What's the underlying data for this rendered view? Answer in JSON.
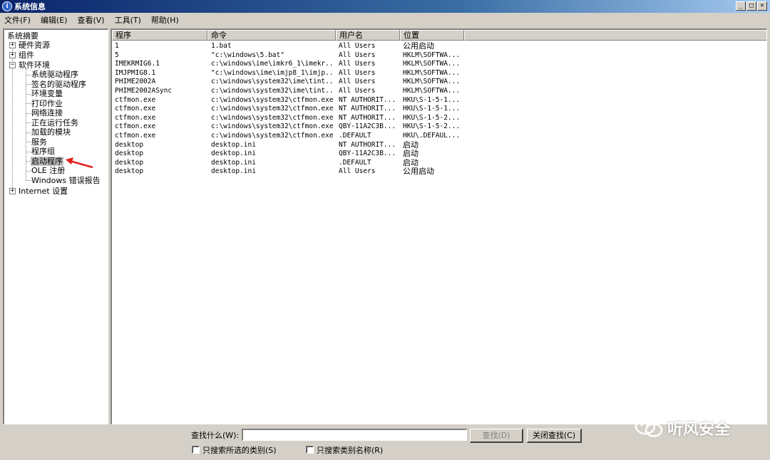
{
  "window": {
    "title": "系统信息",
    "min": "_",
    "max": "□",
    "close": "×"
  },
  "menu": [
    "文件(F)",
    "编辑(E)",
    "查看(V)",
    "工具(T)",
    "帮助(H)"
  ],
  "tree": {
    "root": "系统摘要",
    "hardware": "硬件资源",
    "components": "组件",
    "software": "软件环境",
    "software_children": [
      "系统驱动程序",
      "签名的驱动程序",
      "环境变量",
      "打印作业",
      "网络连接",
      "正在运行任务",
      "加载的模块",
      "服务",
      "程序组",
      "启动程序",
      "OLE 注册",
      "Windows 错误报告"
    ],
    "internet": "Internet 设置",
    "selected": "启动程序"
  },
  "table": {
    "columns": [
      "程序",
      "命令",
      "用户名",
      "位置"
    ],
    "rows": [
      [
        "1",
        "1.bat",
        "All Users",
        "公用启动"
      ],
      [
        "5",
        "\"c:\\windows\\5.bat\"",
        "All Users",
        "HKLM\\SOFTWA..."
      ],
      [
        "IMEKRMIG6.1",
        "c:\\windows\\ime\\imkr6_1\\imekr...",
        "All Users",
        "HKLM\\SOFTWA..."
      ],
      [
        "IMJPMIG8.1",
        "\"c:\\windows\\ime\\imjp8_1\\imjp...",
        "All Users",
        "HKLM\\SOFTWA..."
      ],
      [
        "PHIME2002A",
        "c:\\windows\\system32\\ime\\tint...",
        "All Users",
        "HKLM\\SOFTWA..."
      ],
      [
        "PHIME2002ASync",
        "c:\\windows\\system32\\ime\\tint...",
        "All Users",
        "HKLM\\SOFTWA..."
      ],
      [
        "ctfmon.exe",
        "c:\\windows\\system32\\ctfmon.exe",
        "NT AUTHORIT...",
        "HKU\\S-1-5-1..."
      ],
      [
        "ctfmon.exe",
        "c:\\windows\\system32\\ctfmon.exe",
        "NT AUTHORIT...",
        "HKU\\S-1-5-1..."
      ],
      [
        "ctfmon.exe",
        "c:\\windows\\system32\\ctfmon.exe",
        "NT AUTHORIT...",
        "HKU\\S-1-5-2..."
      ],
      [
        "ctfmon.exe",
        "c:\\windows\\system32\\ctfmon.exe",
        "QBY-11A2C3B...",
        "HKU\\S-1-5-2..."
      ],
      [
        "ctfmon.exe",
        "c:\\windows\\system32\\ctfmon.exe",
        ".DEFAULT",
        "HKU\\.DEFAUL..."
      ],
      [
        "desktop",
        "desktop.ini",
        "NT AUTHORIT...",
        "启动"
      ],
      [
        "desktop",
        "desktop.ini",
        "QBY-11A2C3B...",
        "启动"
      ],
      [
        "desktop",
        "desktop.ini",
        ".DEFAULT",
        "启动"
      ],
      [
        "desktop",
        "desktop.ini",
        "All Users",
        "公用启动"
      ]
    ]
  },
  "find": {
    "label": "查找什么(W):",
    "value": "",
    "find_button": "查找(D)",
    "close_button": "关闭查找(C)",
    "option1": "只搜索所选的类别(S)",
    "option2": "只搜索类别名称(R)"
  },
  "watermark": "听风安全",
  "colors": {
    "arrow": "#e0201a",
    "titlebar": "#0a246a"
  }
}
